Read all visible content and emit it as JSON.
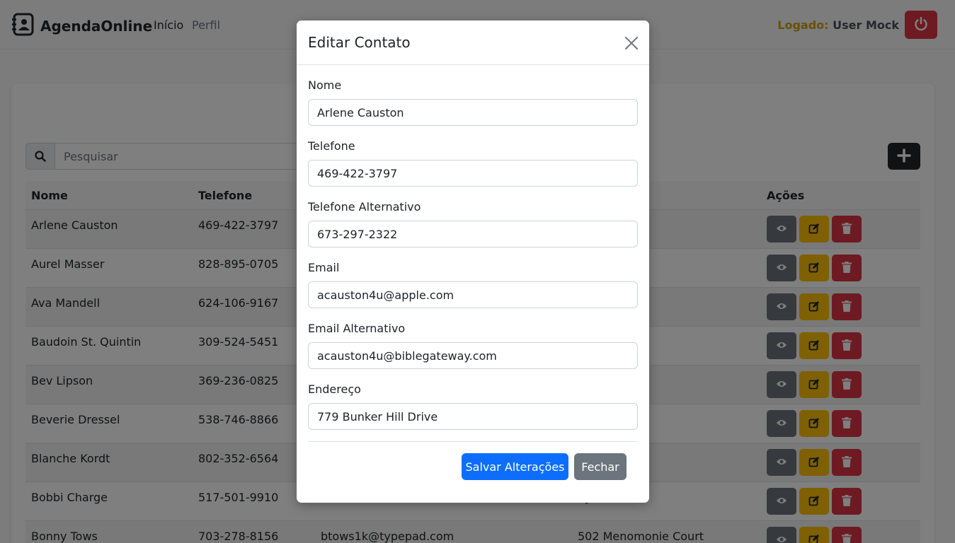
{
  "navbar": {
    "brand": "AgendaOnline",
    "links": [
      "Início",
      "Perfil"
    ],
    "logged_label": "Logado:",
    "logged_user": "User Mock"
  },
  "search": {
    "placeholder": "Pesquisar"
  },
  "table": {
    "headers": [
      "Nome",
      "Telefone",
      "",
      "",
      "Ações"
    ],
    "rows": [
      {
        "nome": "Arlene Causton",
        "telefone": "469-422-3797",
        "email": "",
        "endereco": "ll Drive"
      },
      {
        "nome": "Aurel Masser",
        "telefone": "828-895-0705",
        "email": "",
        "endereco": "rive"
      },
      {
        "nome": "Ava Mandell",
        "telefone": "624-106-9167",
        "email": "",
        "endereco": ""
      },
      {
        "nome": "Baudoin St. Quintin",
        "telefone": "309-524-5451",
        "email": "",
        "endereco": "rive"
      },
      {
        "nome": "Bev Lipson",
        "telefone": "369-236-0825",
        "email": "",
        "endereco": "ing"
      },
      {
        "nome": "Beverie Dressel",
        "telefone": "538-746-8866",
        "email": "",
        "endereco": "Terrace"
      },
      {
        "nome": "Blanche Kordt",
        "telefone": "802-352-6564",
        "email": "",
        "endereco": "Street"
      },
      {
        "nome": "Bobbi Charge",
        "telefone": "517-501-9910",
        "email": "",
        "endereco": "ey"
      },
      {
        "nome": "Bonny Tows",
        "telefone": "703-278-8156",
        "email": "btows1k@typepad.com",
        "endereco": "502 Menomonie Court"
      }
    ]
  },
  "modal": {
    "title": "Editar Contato",
    "fields": [
      {
        "label": "Nome",
        "value": "Arlene Causton"
      },
      {
        "label": "Telefone",
        "value": "469-422-3797"
      },
      {
        "label": "Telefone Alternativo",
        "value": "673-297-2322"
      },
      {
        "label": "Email",
        "value": "acauston4u@apple.com"
      },
      {
        "label": "Email Alternativo",
        "value": "acauston4u@biblegateway.com"
      },
      {
        "label": "Endereço",
        "value": "779 Bunker Hill Drive"
      }
    ],
    "save_label": "Salvar Alterações",
    "close_label": "Fechar"
  },
  "colors": {
    "primary": "#0d6efd",
    "secondary": "#6c757d",
    "danger": "#dc3545",
    "warning": "#ffc107",
    "dark": "#212529",
    "logged_label": "#d4a00a"
  },
  "icons": {
    "brand": "address-book-icon",
    "logout": "power-icon",
    "search": "search-icon",
    "add": "plus-icon",
    "view": "eye-icon",
    "edit": "edit-icon",
    "delete": "trash-icon",
    "close": "close-icon"
  }
}
